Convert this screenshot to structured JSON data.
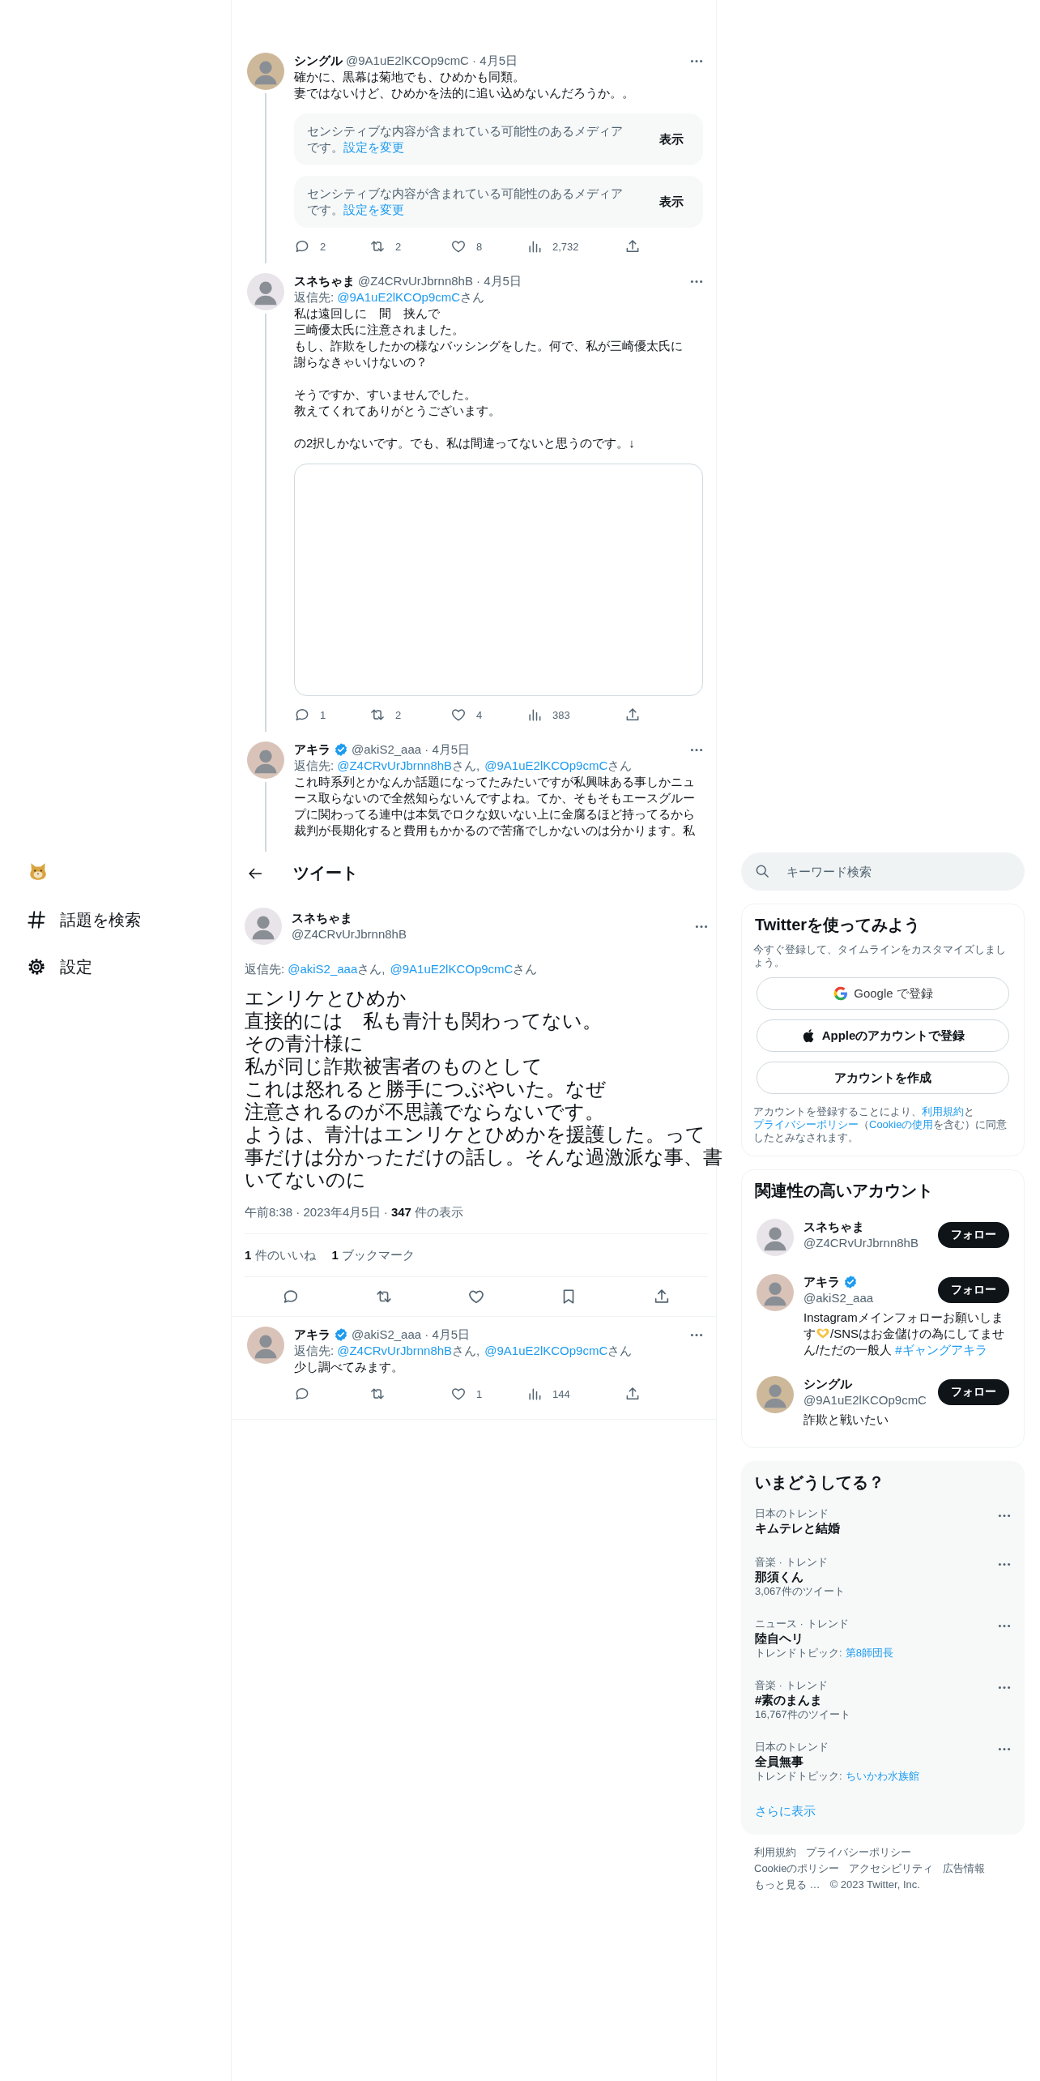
{
  "nav": {
    "items": [
      {
        "label": "話題を検索"
      },
      {
        "label": "設定"
      }
    ]
  },
  "thread": [
    {
      "name": "シングル",
      "verified": false,
      "meta": "@9A1uE2lKCOp9cmC · 4月5日",
      "paragraphs": [
        [
          "確かに、黒幕は菊地でも、ひめかも同類。",
          "妻ではないけど、ひめかを法的に追い込めないんだろうか。。"
        ]
      ],
      "media": [
        {
          "kind": "sensitive",
          "text": "センシティブな内容が含まれている可能性のあるメディアです。",
          "link": "設定を変更",
          "button": "表示"
        },
        {
          "kind": "sensitive",
          "text": "センシティブな内容が含まれている可能性のあるメディアです。",
          "link": "設定を変更",
          "button": "表示"
        }
      ],
      "actions": [
        {
          "kind": "reply",
          "count": "2"
        },
        {
          "kind": "retweet",
          "count": "2"
        },
        {
          "kind": "like",
          "count": "8"
        },
        {
          "kind": "views",
          "count": "2,732"
        },
        {
          "kind": "share"
        }
      ]
    },
    {
      "name": "スネちゃま",
      "verified": false,
      "meta": "@Z4CRvUrJbrnn8hB · 4月5日",
      "reply_label": "返信先:",
      "reply_to": [
        {
          "mention": "@9A1uE2lKCOp9cmC",
          "suffix": "さん"
        }
      ],
      "paragraphs": [
        [
          "私は遠回しに　間　挟んで",
          "三崎優太氏に注意されました。",
          "もし、詐欺をしたかの様なバッシングをした。何で、私が三崎優太氏に",
          "謝らなきゃいけないの？"
        ],
        [
          "そうですか、すいませんでした。",
          "教えてくれてありがとうございます。"
        ],
        [
          "の2択しかないです。でも、私は間違ってないと思うのです。↓"
        ]
      ],
      "media": [
        {
          "kind": "blank"
        }
      ],
      "actions": [
        {
          "kind": "reply",
          "count": "1"
        },
        {
          "kind": "retweet",
          "count": "2"
        },
        {
          "kind": "like",
          "count": "4"
        },
        {
          "kind": "views",
          "count": "383"
        },
        {
          "kind": "share"
        }
      ]
    },
    {
      "name": "アキラ",
      "verified": true,
      "meta": "@akiS2_aaa · 4月5日",
      "reply_label": "返信先:",
      "reply_to": [
        {
          "mention": "@Z4CRvUrJbrnn8hB",
          "suffix": "さん,"
        },
        {
          "mention": "@9A1uE2lKCOp9cmC",
          "suffix": "さん"
        }
      ],
      "paragraphs": [
        [
          "これ時系列とかなんか話題になってたみたいですが私興味ある事しかニュース取らないので全然知らないんですよね。てか、そもそもエースグループに関わってる連中は本気でロクな奴いない上に金腐るほど持ってるから裁判が長期化すると費用もかかるので苦痛でしかないのは分かります。私"
        ]
      ]
    }
  ],
  "header": {
    "title": "ツイート"
  },
  "main_tweet": {
    "name": "スネちゃま",
    "handle": "@Z4CRvUrJbrnn8hB",
    "reply_label": "返信先:",
    "reply_to": [
      {
        "mention": "@akiS2_aaa",
        "suffix": "さん,"
      },
      {
        "mention": "@9A1uE2lKCOp9cmC",
        "suffix": "さん"
      }
    ],
    "paragraphs": [
      [
        "エンリケとひめか",
        "直接的には　私も青汁も関わってない。",
        "その青汁様に",
        "私が同じ詐欺被害者のものとして",
        "これは怒れると勝手につぶやいた。なぜ",
        "注意されるのが不思議でならないです。",
        "ようは、青汁はエンリケとひめかを援護した。って",
        "事だけは分かっただけの話し。そんな過激派な事、書いてないのに"
      ]
    ],
    "info": "午前8:38 · 2023年4月5日 · **347** 件の表示",
    "stats": [
      "**1** 件のいいね",
      "**1** ブックマーク"
    ],
    "actions": [
      {
        "kind": "reply"
      },
      {
        "kind": "retweet"
      },
      {
        "kind": "like"
      },
      {
        "kind": "bookmark"
      },
      {
        "kind": "share"
      }
    ]
  },
  "replies": [
    {
      "name": "アキラ",
      "verified": true,
      "meta": "@akiS2_aaa · 4月5日",
      "reply_label": "返信先:",
      "reply_to": [
        {
          "mention": "@Z4CRvUrJbrnn8hB",
          "suffix": "さん,"
        },
        {
          "mention": "@9A1uE2lKCOp9cmC",
          "suffix": "さん"
        }
      ],
      "paragraphs": [
        [
          "少し調べてみます。"
        ]
      ],
      "actions": [
        {
          "kind": "reply"
        },
        {
          "kind": "retweet"
        },
        {
          "kind": "like",
          "count": "1"
        },
        {
          "kind": "views",
          "count": "144"
        },
        {
          "kind": "share"
        }
      ]
    }
  ],
  "sidebar": {
    "search": {
      "placeholder": "キーワード検索"
    },
    "signup": {
      "title": "Twitterを使ってみよう",
      "subtitle": "今すぐ登録して、タイムラインをカスタマイズしましょう。",
      "buttons": [
        {
          "kind": "google",
          "label": "Google で登録"
        },
        {
          "kind": "apple",
          "label": "Appleのアカウントで登録"
        },
        {
          "kind": "plain",
          "label": "アカウントを作成"
        }
      ],
      "legal": [
        {
          "kind": "text",
          "text": "アカウントを登録することにより、"
        },
        {
          "kind": "link",
          "text": "利用規約"
        },
        {
          "kind": "text",
          "text": "と"
        },
        {
          "kind": "link",
          "text": "プライバシーポリシー"
        },
        {
          "kind": "text",
          "text": "（"
        },
        {
          "kind": "link",
          "text": "Cookieの使用"
        },
        {
          "kind": "text",
          "text": "を含む）に同意したとみなされます。"
        }
      ]
    },
    "follow": {
      "title": "関連性の高いアカウント",
      "accounts": [
        {
          "name": "スネちゃま",
          "verified": false,
          "handle": "@Z4CRvUrJbrnn8hB",
          "button": "フォロー"
        },
        {
          "name": "アキラ",
          "verified": true,
          "handle": "@akiS2_aaa",
          "button": "フォロー",
          "bio": [
            {
              "kind": "text",
              "text": "Instagramメインフォローお願いします"
            },
            {
              "kind": "emoji"
            },
            {
              "kind": "text",
              "text": "/SNSはお金儲けの為にしてません/ただの一般人"
            },
            {
              "kind": "link",
              "text": "#ギャングアキラ"
            }
          ]
        },
        {
          "name": "シングル",
          "verified": false,
          "handle": "@9A1uE2lKCOp9cmC",
          "button": "フォロー",
          "bio": [
            {
              "kind": "text",
              "text": "詐欺と戦いたい"
            }
          ]
        }
      ]
    },
    "trends": {
      "title": "いまどうしてる？",
      "items": [
        {
          "context": "日本のトレンド",
          "name": "キムテレと結婚"
        },
        {
          "context": "音楽 · トレンド",
          "name": "那須くん",
          "detail": "3,067件のツイート"
        },
        {
          "context": "ニュース · トレンド",
          "name": "陸自ヘリ",
          "detail": "トレンドトピック:",
          "link": "第8師団長"
        },
        {
          "context": "音楽 · トレンド",
          "name": "#素のまんま",
          "detail": "16,767件のツイート"
        },
        {
          "context": "日本のトレンド",
          "name": "全員無事",
          "detail": "トレンドトピック:",
          "link": "ちいかわ水族館"
        }
      ],
      "more": "さらに表示"
    },
    "footer": [
      "利用規約",
      "プライバシーポリシー",
      "Cookieのポリシー",
      "アクセシビリティ",
      "広告情報",
      "もっと見る …",
      "© 2023 Twitter, Inc."
    ]
  }
}
